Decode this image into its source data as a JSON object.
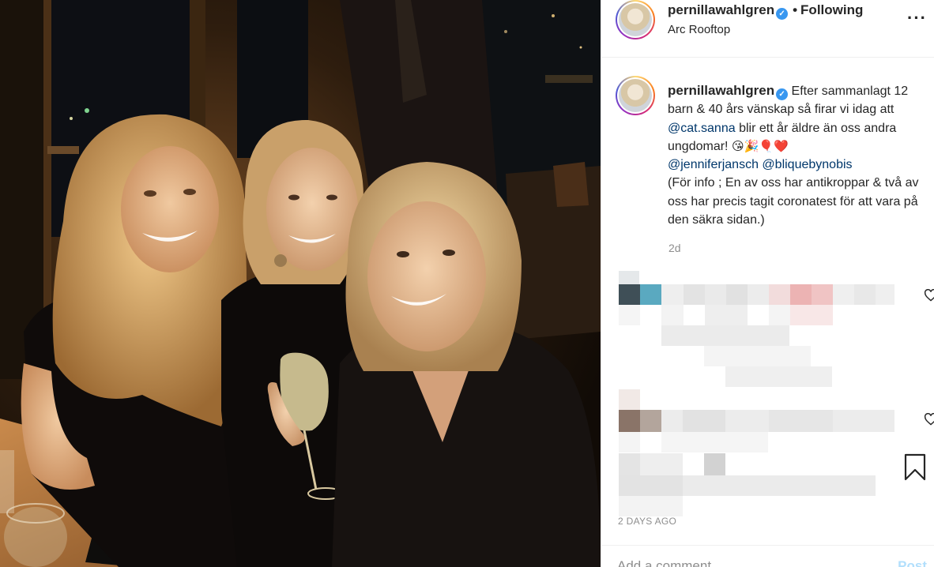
{
  "post": {
    "photo_alt": "",
    "author": {
      "username": "pernillawahlgren",
      "verified": true,
      "follow_status": "Following",
      "location": "Arc Rooftop"
    },
    "caption": {
      "line1_text": "Efter sammanlagt 12 barn & 40 års vänskap så firar vi idag att",
      "mention_1": "@cat.sanna",
      "line2_text": "blir ett år äldre än oss andra ungdomar!",
      "emojis": "😘🎉🎈❤️",
      "mention_2": "@jenniferjansch",
      "mention_3": "@bliquebynobis",
      "footnote": "(För info ; En av oss har antikroppar & två av oss har precis tagit coronatest för att vara på den säkra sidan.)"
    },
    "age": "2d",
    "date": "2 DAYS AGO",
    "more_icon": "···",
    "comment_placeholder": "Add a comment...",
    "post_label": "Post"
  },
  "colors": {
    "link": "#00376b",
    "muted": "#8e8e8e",
    "verified": "#3897f0",
    "post_disabled": "#b2dffc"
  },
  "icons": [
    "verified-badge-icon",
    "more-options-icon",
    "heart-icon",
    "bookmark-icon"
  ]
}
